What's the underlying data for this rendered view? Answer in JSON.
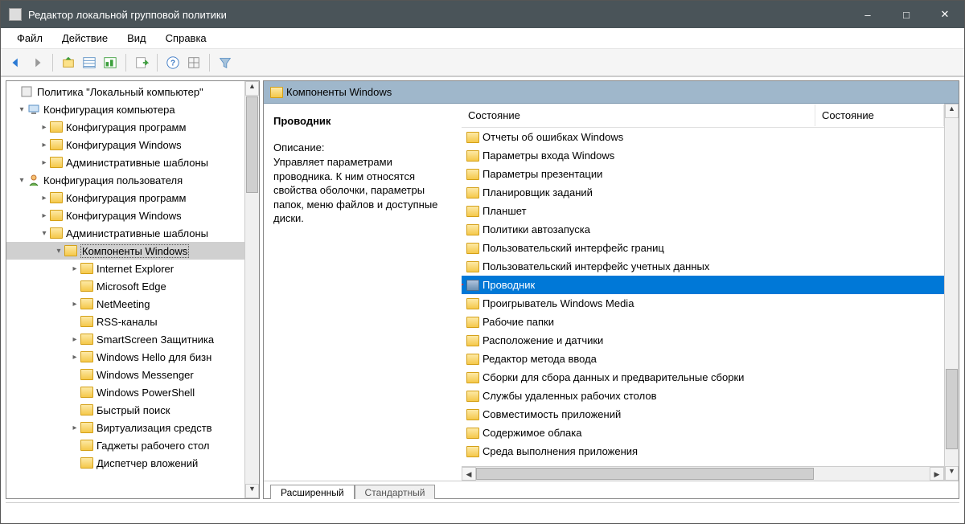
{
  "window": {
    "title": "Редактор локальной групповой политики"
  },
  "menu": {
    "file": "Файл",
    "action": "Действие",
    "view": "Вид",
    "help": "Справка"
  },
  "tree": {
    "root": "Политика \"Локальный компьютер\"",
    "comp_config": "Конфигурация компьютера",
    "comp_soft": "Конфигурация программ",
    "comp_win": "Конфигурация Windows",
    "comp_admin": "Административные шаблоны",
    "user_config": "Конфигурация пользователя",
    "user_soft": "Конфигурация программ",
    "user_win": "Конфигурация Windows",
    "user_admin": "Административные шаблоны",
    "win_components": "Компоненты Windows",
    "ie": "Internet Explorer",
    "edge": "Microsoft Edge",
    "netmeeting": "NetMeeting",
    "rss": "RSS-каналы",
    "smartscreen": "SmartScreen Защитника",
    "hello": "Windows Hello для бизн",
    "messenger": "Windows Messenger",
    "powershell": "Windows PowerShell",
    "quicksearch": "Быстрый поиск",
    "virt": "Виртуализация средств",
    "gadgets": "Гаджеты рабочего стол",
    "dispatcher": "Диспетчер вложений"
  },
  "breadcrumb": "Компоненты Windows",
  "details": {
    "title": "Проводник",
    "desc_label": "Описание:",
    "desc_text": "Управляет параметрами проводника. К ним относятся свойства оболочки, параметры папок, меню файлов и доступные диски."
  },
  "columns": {
    "c1": "Состояние",
    "c2": "Состояние"
  },
  "list": [
    "Отчеты об ошибках Windows",
    "Параметры входа Windows",
    "Параметры презентации",
    "Планировщик заданий",
    "Планшет",
    "Политики автозапуска",
    "Пользовательский интерфейс границ",
    "Пользовательский интерфейс учетных данных",
    "Проводник",
    "Проигрыватель Windows Media",
    "Рабочие папки",
    "Расположение и датчики",
    "Редактор метода ввода",
    "Сборки для сбора данных и предварительные сборки",
    "Службы удаленных рабочих столов",
    "Совместимость приложений",
    "Содержимое облака",
    "Среда выполнения приложения"
  ],
  "selected_index": 8,
  "tabs": {
    "extended": "Расширенный",
    "standard": "Стандартный"
  }
}
